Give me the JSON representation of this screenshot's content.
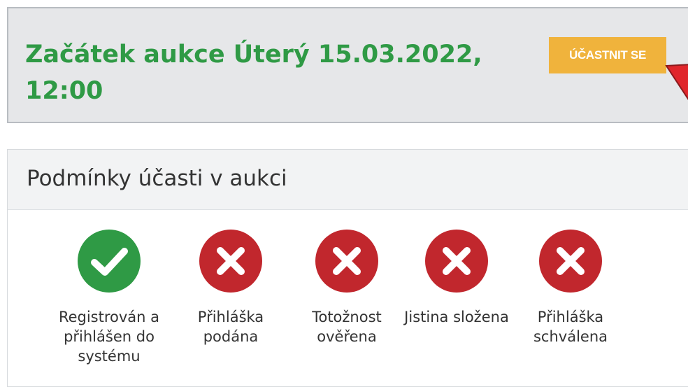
{
  "auction": {
    "title": "Začátek aukce Úterý 15.03.2022, 12:00",
    "participate_label": "ÚČASTNIT SE"
  },
  "conditions": {
    "title": "Podmínky účasti v aukci",
    "items": [
      {
        "label": "Registrován a přihlášen do systému",
        "status": "ok",
        "icon": "check-icon"
      },
      {
        "label": "Přihláška podána",
        "status": "fail",
        "icon": "x-icon"
      },
      {
        "label": "Totožnost ověřena",
        "status": "fail",
        "icon": "x-icon"
      },
      {
        "label": "Jistina složena",
        "status": "fail",
        "icon": "x-icon"
      },
      {
        "label": "Přihláška schválena",
        "status": "fail",
        "icon": "x-icon"
      }
    ]
  },
  "colors": {
    "green": "#2f9a45",
    "red": "#c1272d",
    "button": "#f0b33c",
    "arrow": "#e0262b"
  }
}
